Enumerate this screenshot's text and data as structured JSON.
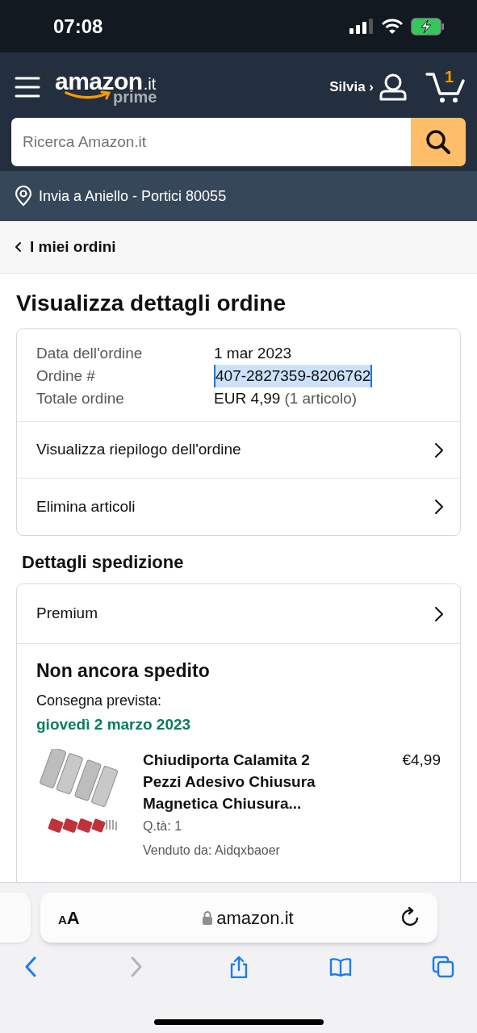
{
  "status_bar": {
    "time": "07:08"
  },
  "header": {
    "logo": {
      "word": "amazon",
      "domain": ".it",
      "tier": "prime"
    },
    "account": "Silvia ›",
    "cart_count": "1"
  },
  "search": {
    "placeholder": "Ricerca Amazon.it"
  },
  "delivery": {
    "text": "Invia a Aniello - Portici 80055"
  },
  "breadcrumb": {
    "label": "I miei ordini"
  },
  "title": "Visualizza dettagli ordine",
  "order_info": [
    {
      "label": "Data dell'ordine",
      "value": "1 mar 2023",
      "selected": false
    },
    {
      "label": "Ordine #",
      "value": "407-2827359-8206762",
      "selected": true
    },
    {
      "label": "Totale ordine",
      "value": "EUR 4,99",
      "note": "(1 articolo)",
      "selected": false
    }
  ],
  "order_links": [
    "Visualizza riepilogo dell'ordine",
    "Elimina articoli"
  ],
  "shipping": {
    "heading": "Dettagli spedizione",
    "method": "Premium",
    "status": "Non ancora spedito",
    "eta_label": "Consegna prevista:",
    "eta_date": "giovedì 2 marzo 2023",
    "items": [
      {
        "kind": "picture",
        "title": "Chiudiporta Calamita 2 Pezzi Adesivo Chiusura Magnetica Chiusura...",
        "price": "€4,99",
        "quantity": "Q.tà: 1",
        "seller": "Venduto da: Aidqxbaoer"
      }
    ]
  },
  "browser": {
    "text_size": "AA",
    "url": "amazon.it",
    "toolbar": [
      {
        "kind": "back",
        "disabled": false
      },
      {
        "kind": "forward",
        "disabled": true
      },
      {
        "kind": "share",
        "disabled": false
      },
      {
        "kind": "bookmarks",
        "disabled": false
      },
      {
        "kind": "tabs",
        "disabled": false
      }
    ]
  }
}
